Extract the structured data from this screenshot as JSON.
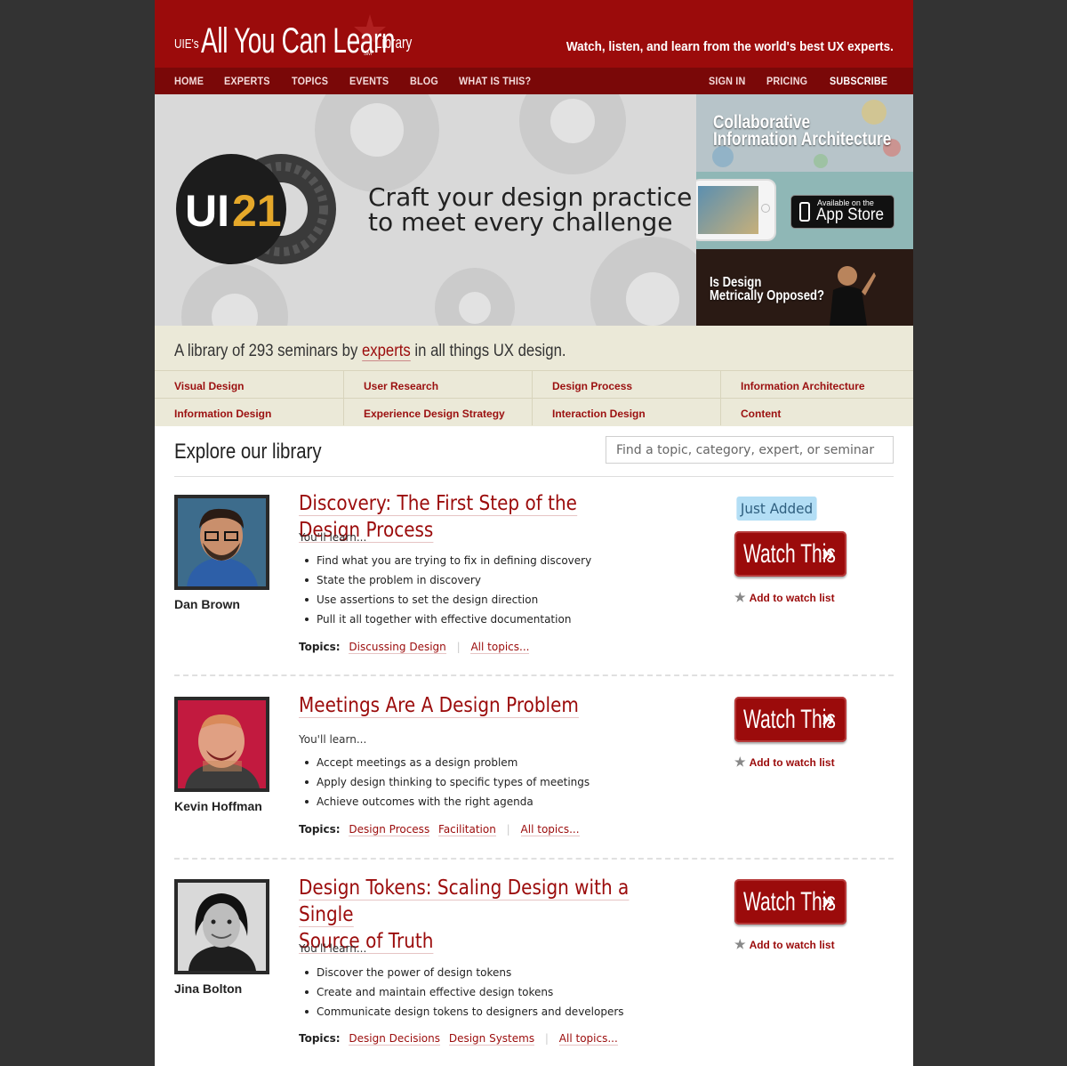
{
  "header": {
    "logo_prefix": "UIE's",
    "logo_main": "All You Can Learn",
    "logo_sm": "SM",
    "logo_suffix": "Library",
    "tagline": "Watch, listen, and learn from the world's best UX experts."
  },
  "nav": {
    "left": [
      "HOME",
      "EXPERTS",
      "TOPICS",
      "EVENTS",
      "BLOG",
      "WHAT IS THIS?"
    ],
    "right": [
      "SIGN IN",
      "PRICING",
      "SUBSCRIBE"
    ]
  },
  "hero": {
    "badge_ui": "UI",
    "badge_num": "21",
    "headline_line1": "Craft your design practice",
    "headline_line2": "to meet every challenge"
  },
  "promos": {
    "ia_line1": "Collaborative",
    "ia_line2": "Information Architecture",
    "app_small": "Available on the",
    "app_big": "App Store",
    "metric_line1": "Is Design",
    "metric_line2": "Metrically Opposed?"
  },
  "library": {
    "intro_before": "A library of 293 seminars by ",
    "intro_link": "experts",
    "intro_after": " in all things UX design.",
    "categories": [
      "Visual Design",
      "User Research",
      "Design Process",
      "Information Architecture",
      "Information Design",
      "Experience Design Strategy",
      "Interaction Design",
      "Content"
    ]
  },
  "explore": {
    "title": "Explore our library",
    "search_placeholder": "Find a topic, category, expert, or seminar"
  },
  "common": {
    "learn_label": "You'll learn...",
    "topics_label": "Topics:",
    "watch_label": "Watch This",
    "watch_chevron": "»",
    "watchlist_label": "Add to watch list",
    "all_topics": "All topics..."
  },
  "seminars": [
    {
      "expert": "Dan Brown",
      "title": "Discovery: The First Step of the Design Process",
      "badge": "Just Added",
      "bullets": [
        "Find what you are trying to fix in defining discovery",
        "State the problem in discovery",
        "Use assertions to set the design direction",
        "Pull it all together with effective documentation"
      ],
      "topics": [
        "Discussing Design"
      ]
    },
    {
      "expert": "Kevin Hoffman",
      "title": "Meetings Are A Design Problem",
      "bullets": [
        "Accept meetings as a design problem",
        "Apply design thinking to specific types of meetings",
        "Achieve outcomes with the right agenda"
      ],
      "topics": [
        "Design Process",
        "Facilitation"
      ]
    },
    {
      "expert": "Jina Bolton",
      "title_line1": "Design Tokens: Scaling Design with a Single",
      "title_line2": "Source of Truth",
      "bullets": [
        "Discover the power of design tokens",
        "Create and maintain effective design tokens",
        "Communicate design tokens to designers and developers"
      ],
      "topics": [
        "Design Decisions",
        "Design Systems"
      ]
    }
  ],
  "colors": {
    "brand_red": "#9b0b0b",
    "nav_red": "#7a0808",
    "page_bg": "#333333",
    "band_bg": "#ebe9d8",
    "badge_blue": "#b3def5"
  }
}
